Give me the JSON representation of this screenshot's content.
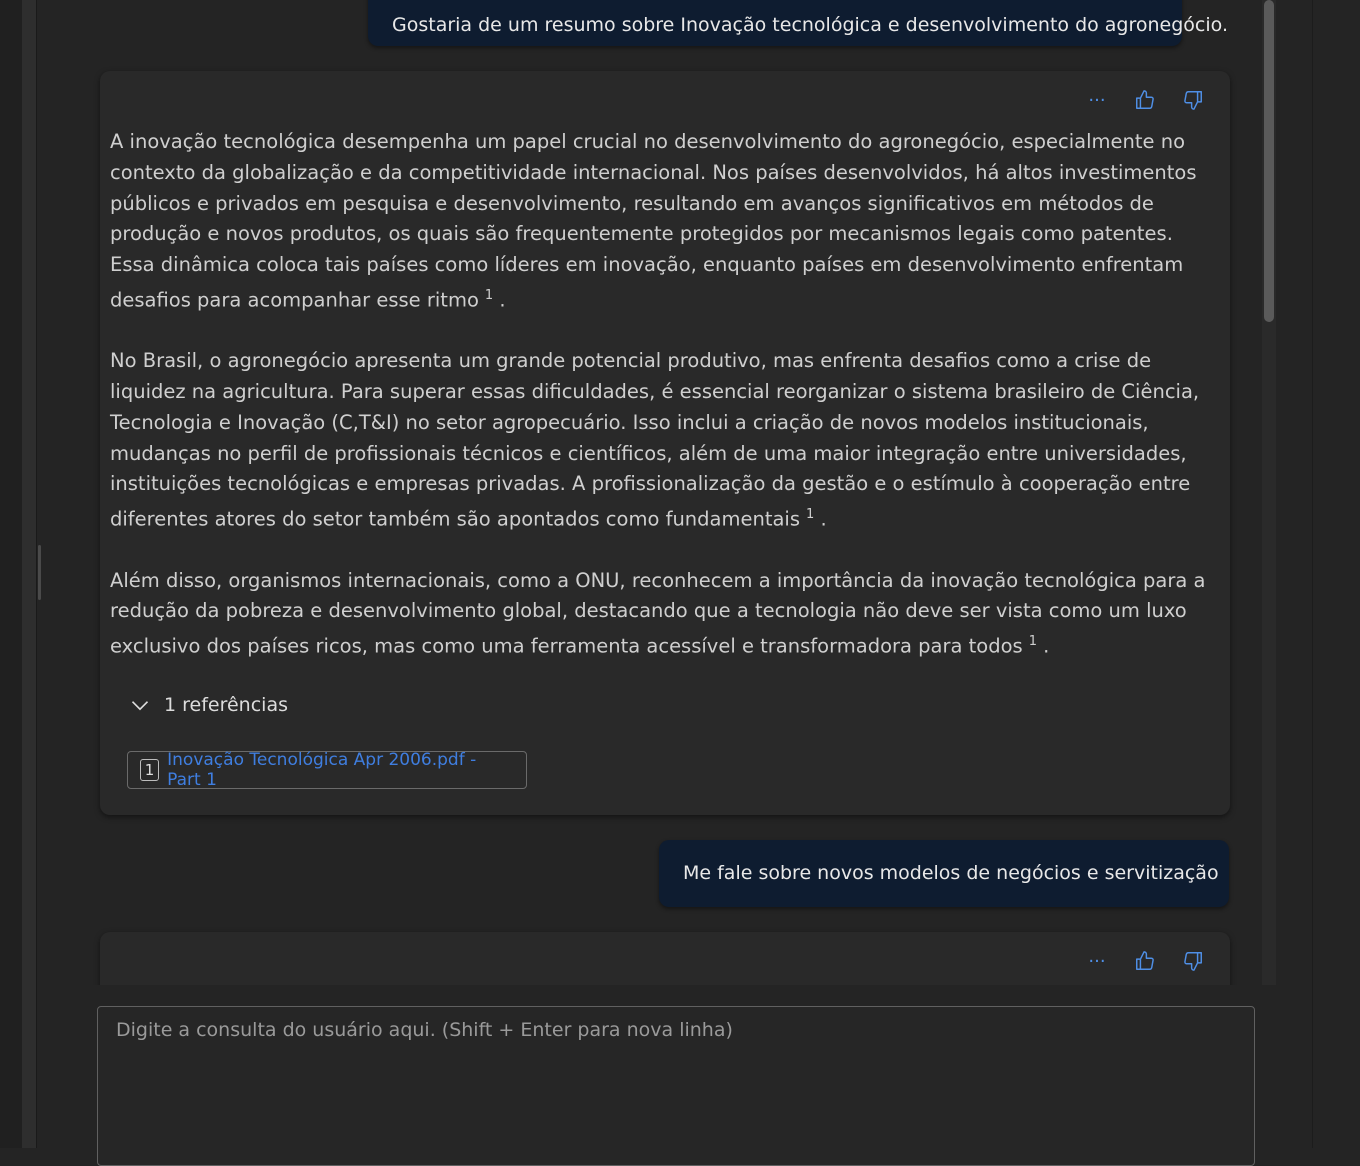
{
  "conversation": {
    "user_message_1": "Gostaria de um resumo sobre Inovação tecnológica e desenvolvimento do agronegócio.",
    "assistant_response_1": {
      "paragraphs": [
        "A inovação tecnológica desempenha um papel crucial no desenvolvimento do agronegócio, especialmente no contexto da globalização e da competitividade internacional. Nos países desenvolvidos, há altos investimentos públicos e privados em pesquisa e desenvolvimento, resultando em avanços significativos em métodos de produção e novos produtos, os quais são frequentemente protegidos por mecanismos legais como patentes. Essa dinâmica coloca tais países como líderes em inovação, enquanto países em desenvolvimento enfrentam desafios para acompanhar esse ritmo",
        "No Brasil, o agronegócio apresenta um grande potencial produtivo, mas enfrenta desafios como a crise de liquidez na agricultura. Para superar essas dificuldades, é essencial reorganizar o sistema brasileiro de Ciência, Tecnologia e Inovação (C,T&I) no setor agropecuário. Isso inclui a criação de novos modelos institucionais, mudanças no perfil de profissionais técnicos e científicos, além de uma maior integração entre universidades, instituições tecnológicas e empresas privadas. A profissionalização da gestão e o estímulo à cooperação entre diferentes atores do setor também são apontados como fundamentais",
        "Além disso, organismos internacionais, como a ONU, reconhecem a importância da inovação tecnológica para a redução da pobreza e desenvolvimento global, destacando que a tecnologia não deve ser vista como um luxo exclusivo dos países ricos, mas como uma ferramenta acessível e transformadora para todos"
      ],
      "citation_marker": "1",
      "references_toggle_label": "1 referências",
      "reference": {
        "number": "1",
        "title": "Inovação Tecnológica Apr 2006.pdf - Part 1"
      }
    },
    "user_message_2": "Me fale sobre novos modelos de negócios e servitização"
  },
  "actions": {
    "more_icon": "ellipsis-icon",
    "like_icon": "thumbs-up-icon",
    "dislike_icon": "thumbs-down-icon",
    "more_glyph": "···"
  },
  "input": {
    "placeholder": "Digite a consulta do usuário aqui. (Shift + Enter para nova linha)"
  },
  "colors": {
    "accent": "#4f8fe6",
    "user_bubble": "#0e1c30",
    "card": "#292929",
    "background": "#242424"
  }
}
